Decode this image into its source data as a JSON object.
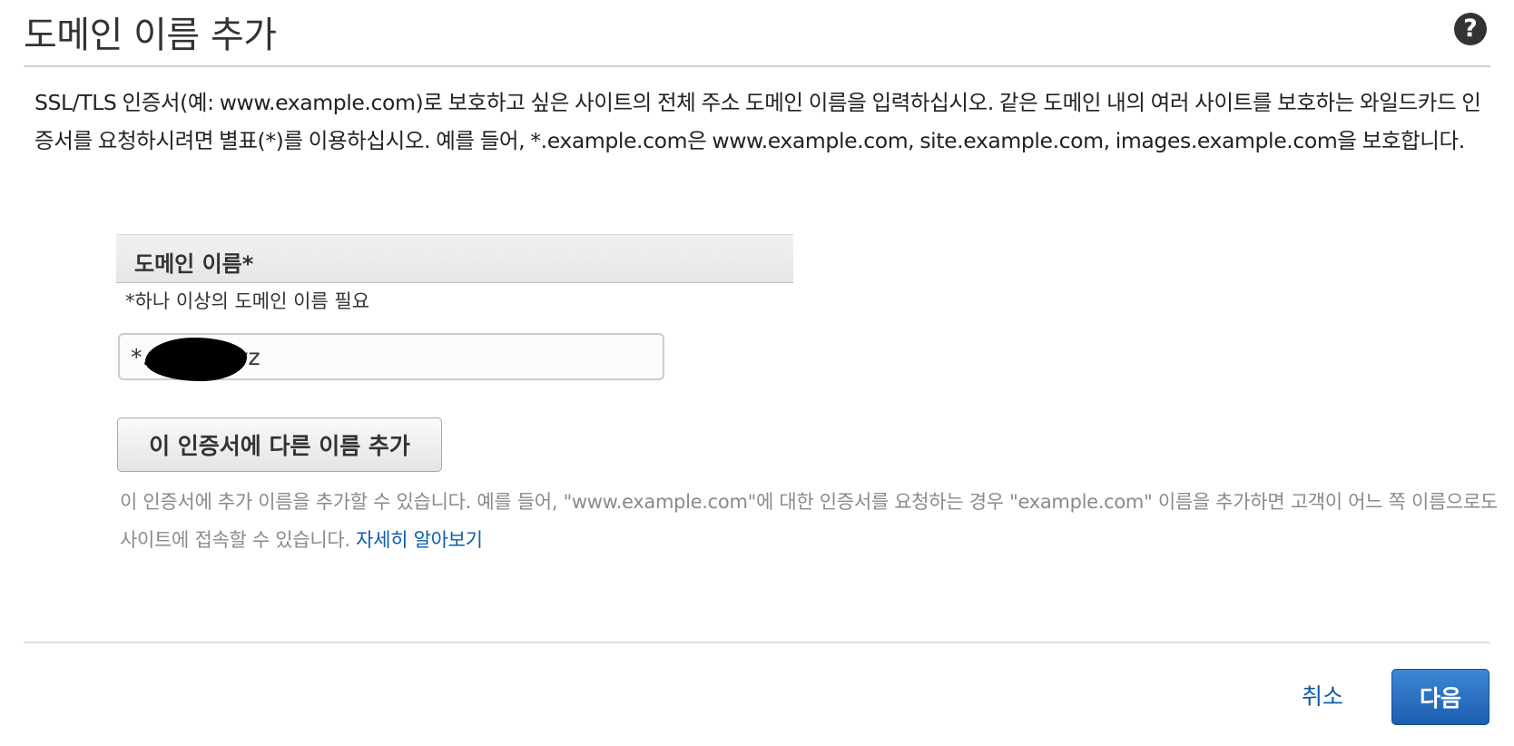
{
  "header": {
    "title": "도메인 이름 추가",
    "help_icon": "question-circle-icon"
  },
  "description": {
    "text": "SSL/TLS 인증서(예: www.example.com)로 보호하고 싶은 사이트의 전체 주소 도메인 이름을 입력하십시오. 같은 도메인 내의 여러 사이트를 보호하는 와일드카드 인증서를 요청하시려면 별표(*)를 이용하십시오. 예를 들어, *.example.com은 www.example.com, site.example.com, images.example.com을 보호합니다."
  },
  "domain_section": {
    "header_label": "도메인 이름*",
    "required_note": "*하나 이상의 도메인 이름 필요",
    "input_value": "*.          xyz",
    "add_name_button": "이 인증서에 다른 이름 추가",
    "help_text": "이 인증서에 추가 이름을 추가할 수 있습니다. 예를 들어, \"www.example.com\"에 대한 인증서를 요청하는 경우 \"example.com\" 이름을 추가하면 고객이 어느 쪽 이름으로도 사이트에 접속할 수 있습니다.",
    "learn_more_link": "자세히 알아보기"
  },
  "footer": {
    "cancel_label": "취소",
    "next_label": "다음"
  },
  "colors": {
    "link": "#0b5ea8",
    "primary_button": "#1f66b8",
    "muted_text": "#8a8a8a"
  }
}
